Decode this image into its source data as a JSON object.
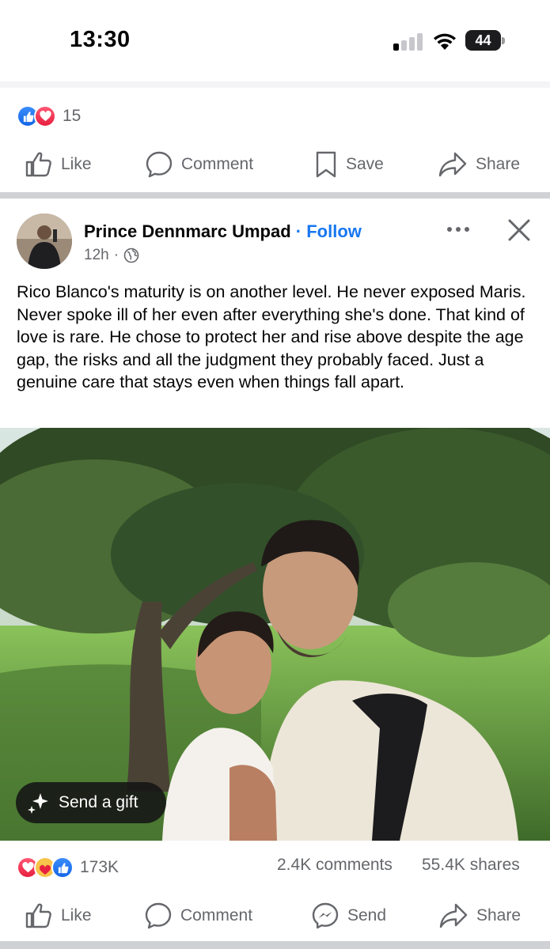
{
  "status_bar": {
    "time": "13:30",
    "battery": "44",
    "signal_bars_active": 1,
    "signal_bars_total": 4
  },
  "prev_post": {
    "reaction_icons": [
      "like",
      "love"
    ],
    "reaction_count": "15",
    "actions": {
      "like": "Like",
      "comment": "Comment",
      "save": "Save",
      "share": "Share"
    }
  },
  "post": {
    "author": "Prince Dennmarc Umpad",
    "separator": "·",
    "follow_label": "Follow",
    "time_ago": "12h",
    "meta_separator": "·",
    "audience_icon": "globe-icon",
    "text": "Rico Blanco's maturity is on another level. He never exposed Maris. Never spoke ill of her even after everything she's done. That kind of love is rare. He chose to protect her and rise above despite the age gap, the risks and all the judgment they probably faced. Just a genuine care that stays even when things fall apart.",
    "gift_label": "Send a gift",
    "reaction_icons": [
      "love",
      "care",
      "like"
    ],
    "reaction_count": "173K",
    "comments": "2.4K comments",
    "shares": "55.4K shares",
    "actions": {
      "like": "Like",
      "comment": "Comment",
      "send": "Send",
      "share": "Share"
    }
  },
  "colors": {
    "accent": "#1877f2",
    "secondary_text": "#65676b",
    "like": "#1466e6",
    "love": "#e8203f",
    "care": "#f7c34a"
  }
}
